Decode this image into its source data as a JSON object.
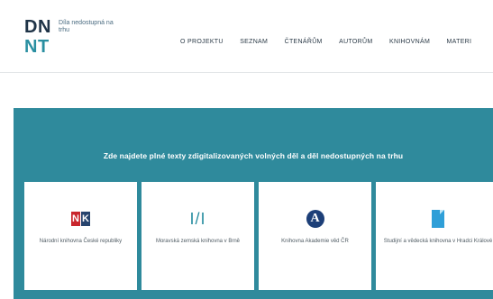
{
  "header": {
    "logo": {
      "line1": "DN",
      "line2": "NT",
      "tagline": "Díla nedostupná na trhu"
    },
    "nav": [
      "O PROJEKTU",
      "SEZNAM",
      "ČTENÁŘŮM",
      "AUTORŮM",
      "KNIHOVNÁM",
      "MATERI"
    ]
  },
  "hero": {
    "title": "Zde najdete plné texty zdigitalizovaných volných děl a děl nedostupných na trhu",
    "cards": [
      {
        "icon": "nk-logo-icon",
        "text": "Národní knihovna České republiky"
      },
      {
        "icon": "mzk-logo-icon",
        "icon_text": "I/I",
        "text": "Moravská zemská knihovna v Brně"
      },
      {
        "icon": "academy-logo-icon",
        "icon_text": "A",
        "text": "Knihovna Akademie věd ČR"
      },
      {
        "icon": "svk-logo-icon",
        "text": "Studijní a vědecká knihovna v Hradci Králové"
      }
    ]
  },
  "colors": {
    "accent": "#2f8a9c",
    "logo_dark": "#1f3347",
    "logo_teal": "#2a8fa1"
  }
}
